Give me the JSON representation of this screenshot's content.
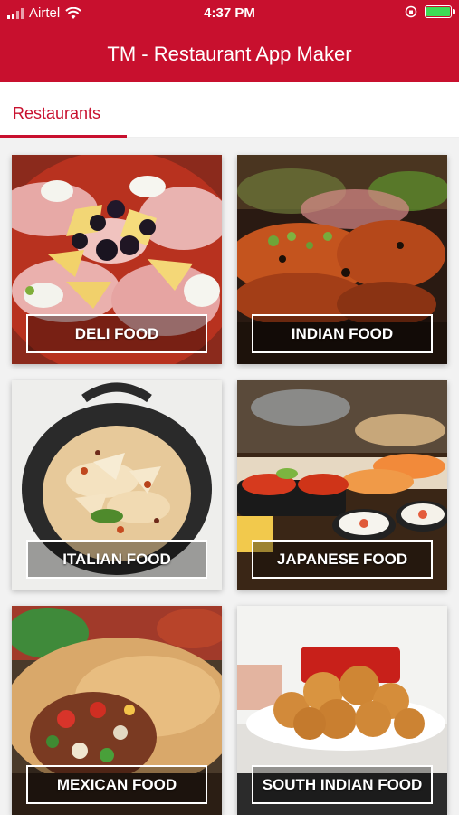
{
  "status": {
    "carrier": "Airtel",
    "time": "4:37 PM",
    "battery_color": "#3ddc55"
  },
  "header": {
    "title": "TM - Restaurant App Maker",
    "bg_color": "#c8102e"
  },
  "tabs": [
    {
      "label": "Restaurants",
      "active": true
    }
  ],
  "categories": [
    {
      "label": "DELI FOOD",
      "photo": "deli-platter"
    },
    {
      "label": "INDIAN FOOD",
      "photo": "tandoori-grill"
    },
    {
      "label": "ITALIAN FOOD",
      "photo": "pasta-pot"
    },
    {
      "label": "JAPANESE FOOD",
      "photo": "sushi-rolls"
    },
    {
      "label": "MEXICAN FOOD",
      "photo": "burrito-wrap"
    },
    {
      "label": "SOUTH INDIAN FOOD",
      "photo": "fried-fritters"
    }
  ]
}
